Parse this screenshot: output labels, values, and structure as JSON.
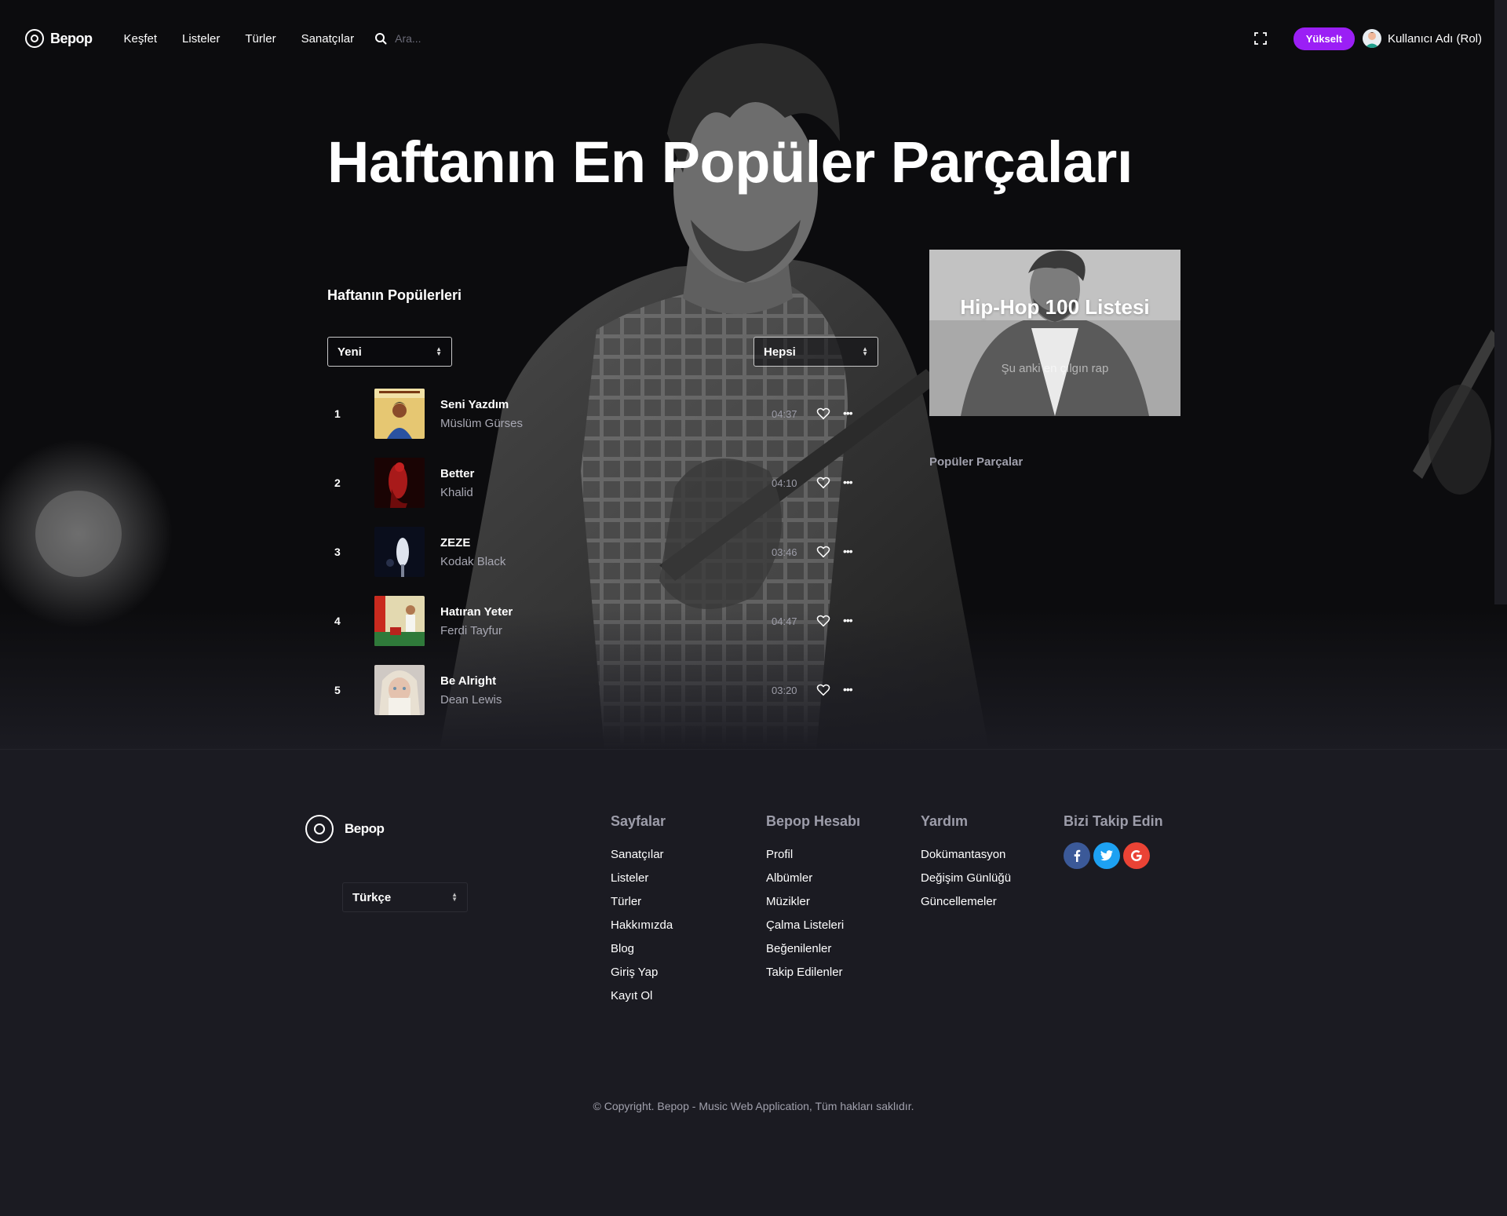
{
  "nav": {
    "logo": "Bepop",
    "links": [
      "Keşfet",
      "Listeler",
      "Türler",
      "Sanatçılar"
    ],
    "search_placeholder": "Ara...",
    "upgrade_label": "Yükselt",
    "user_label": "Kullanıcı Adı (Rol)"
  },
  "hero": {
    "title": "Haftanın En Popüler Parçaları"
  },
  "charts": {
    "section_title": "Haftanın Popülerleri",
    "sort_select": "Yeni",
    "filter_select": "Hepsi",
    "tracks": [
      {
        "num": "1",
        "title": "Seni Yazdım",
        "artist": "Müslüm Gürses",
        "duration": "04:37"
      },
      {
        "num": "2",
        "title": "Better",
        "artist": "Khalid",
        "duration": "04:10"
      },
      {
        "num": "3",
        "title": "ZEZE",
        "artist": "Kodak Black",
        "duration": "03:46"
      },
      {
        "num": "4",
        "title": "Hatıran Yeter",
        "artist": "Ferdi Tayfur",
        "duration": "04:47"
      },
      {
        "num": "5",
        "title": "Be Alright",
        "artist": "Dean Lewis",
        "duration": "03:20"
      }
    ]
  },
  "promo": {
    "title": "Hip-Hop 100 Listesi",
    "subtitle": "Şu anki en çılgın rap"
  },
  "sidebar": {
    "title": "Popüler Parçalar"
  },
  "footer": {
    "logo": "Bepop",
    "language": "Türkçe",
    "columns": [
      {
        "title": "Sayfalar",
        "links": [
          "Sanatçılar",
          "Listeler",
          "Türler",
          "Hakkımızda",
          "Blog",
          "Giriş Yap",
          "Kayıt Ol"
        ]
      },
      {
        "title": "Bepop Hesabı",
        "links": [
          "Profil",
          "Albümler",
          "Müzikler",
          "Çalma Listeleri",
          "Beğenilenler",
          "Takip Edilenler"
        ]
      },
      {
        "title": "Yardım",
        "links": [
          "Dokümantasyon",
          "Değişim Günlüğü",
          "Güncellemeler"
        ]
      }
    ],
    "follow_title": "Bizi Takip Edin",
    "socials": [
      {
        "name": "facebook-icon",
        "glyph": "f",
        "color": "#3b5998"
      },
      {
        "name": "twitter-icon",
        "glyph": "t",
        "color": "#1da1f2"
      },
      {
        "name": "google-icon",
        "glyph": "G",
        "color": "#ea4335"
      }
    ],
    "copyright": "© Copyright. Bepop - Music Web Application, Tüm hakları saklıdır."
  },
  "colors": {
    "accent": "#9b1ff5",
    "background": "#1b1b22"
  }
}
